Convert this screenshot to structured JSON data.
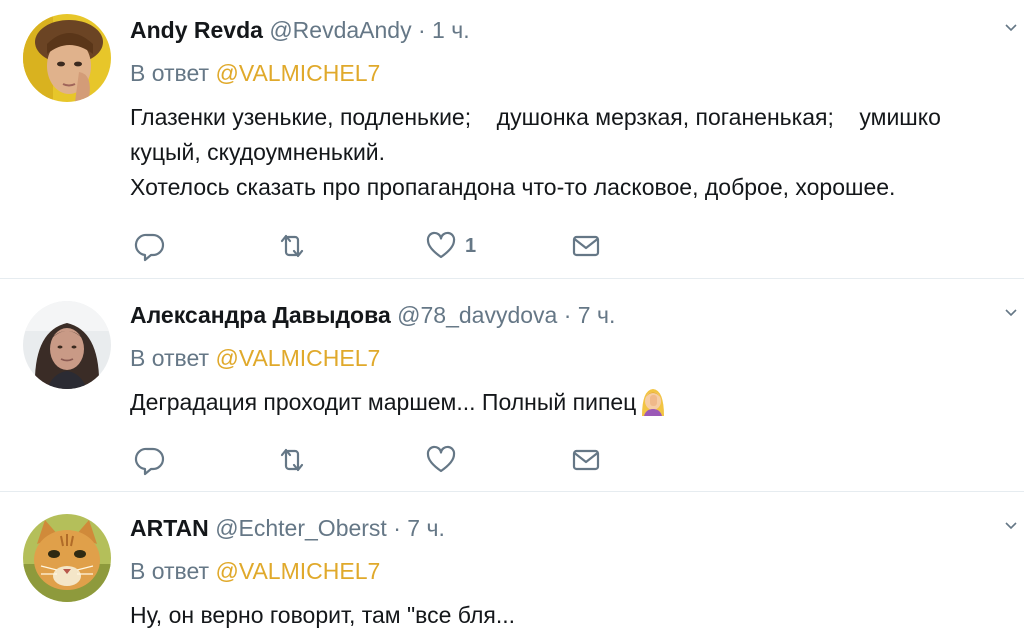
{
  "tweets": [
    {
      "name": "Andy Revda",
      "handle": "@RevdaAndy",
      "separator": "·",
      "time": "1 ч.",
      "reply_prefix": "В ответ",
      "reply_mention": "@VALMICHEL7",
      "text_lines": [
        "Глазенки узенькие, подленькие;    душонка мерзкая, поганенькая;    умишко",
        "куцый, скудоумненький.",
        "Хотелось сказать про пропагандона что-то ласковое, доброе, хорошее."
      ],
      "like_count": "1",
      "avatar_icon": "avatar-young-man-photo"
    },
    {
      "name": "Александра Давыдова",
      "handle": "@78_davydova",
      "separator": "·",
      "time": "7 ч.",
      "reply_prefix": "В ответ",
      "reply_mention": "@VALMICHEL7",
      "text_lines": [
        "Деградация проходит маршем... Полный пипец"
      ],
      "emoji_icon": "woman-facepalming-emoji",
      "avatar_icon": "avatar-woman-photo"
    },
    {
      "name": "ARTAN",
      "handle": "@Echter_Oberst",
      "separator": "·",
      "time": "7 ч.",
      "reply_prefix": "В ответ",
      "reply_mention": "@VALMICHEL7",
      "text_lines": [
        "Ну, он верно говорит, там \"все бля..."
      ],
      "avatar_icon": "avatar-cat-photo"
    }
  ],
  "colors": {
    "mention": "#e0a92b",
    "secondary_text": "#657786",
    "primary_text": "#14171a",
    "divider": "#e6ecf0"
  },
  "icons": [
    "reply-icon",
    "retweet-icon",
    "like-icon",
    "dm-icon",
    "chevron-down-icon"
  ]
}
